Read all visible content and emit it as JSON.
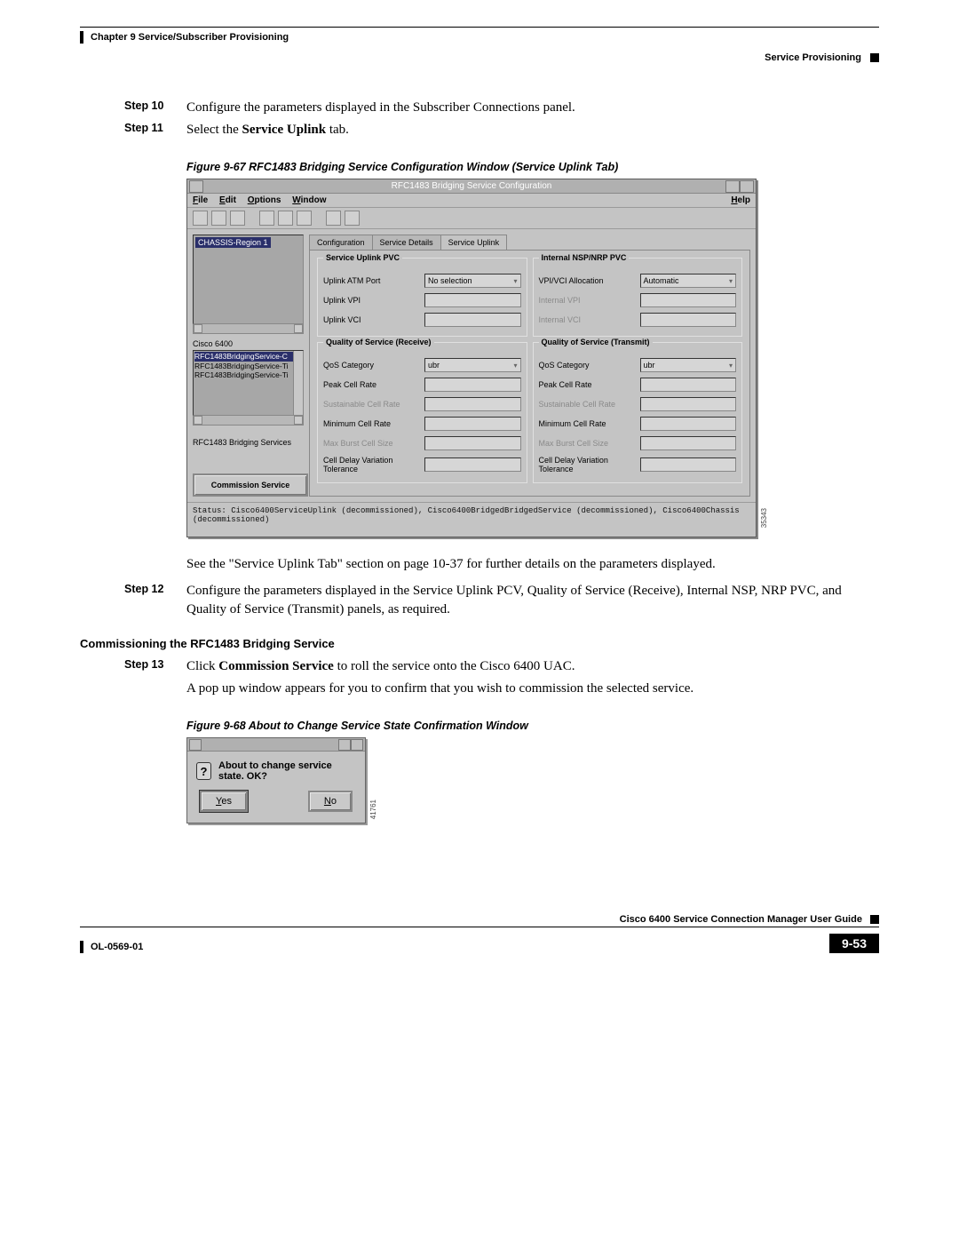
{
  "header": {
    "chapter": "Chapter 9    Service/Subscriber Provisioning",
    "section": "Service Provisioning"
  },
  "steps": {
    "s10": {
      "label": "Step 10",
      "text": "Configure the parameters displayed in the Subscriber Connections panel."
    },
    "s11": {
      "label": "Step 11",
      "prefix": "Select the ",
      "bold": "Service Uplink",
      "suffix": " tab."
    },
    "s12": {
      "label": "Step 12",
      "text": "Configure the parameters displayed in the Service Uplink PCV, Quality of Service (Receive), Internal NSP, NRP PVC, and Quality of Service (Transmit) panels, as required."
    },
    "s13": {
      "label": "Step 13",
      "prefix": "Click ",
      "bold": "Commission Service",
      "suffix": " to roll the service onto the Cisco 6400 UAC."
    }
  },
  "captions": {
    "f67": "Figure 9-67   RFC1483 Bridging Service Configuration Window (Service Uplink Tab)",
    "f68": "Figure 9-68   About to Change Service State Confirmation Window"
  },
  "paragraph_after_fig": "See the \"Service Uplink Tab\" section on page 10-37 for further details on the parameters displayed.",
  "commission_heading": "Commissioning the RFC1483 Bridging Service",
  "popup_paragraph": "A pop up window appears for you to confirm that you wish to commission the selected service.",
  "window": {
    "title": "RFC1483 Bridging Service Configuration",
    "menus": {
      "file": "File",
      "edit": "Edit",
      "options": "Options",
      "window": "Window",
      "help": "Help"
    },
    "tree_selected": "CHASSIS-Region 1",
    "cisco_label": "Cisco 6400",
    "list": {
      "items": [
        "RFC1483BridgingService-C",
        "RFC1483BridgingService-Ti",
        "RFC1483BridgingService-Ti"
      ]
    },
    "services_label": "RFC1483 Bridging Services",
    "commission_btn": "Commission Service",
    "tabs": {
      "configuration": "Configuration",
      "service_details": "Service Details",
      "service_uplink": "Service Uplink"
    },
    "field_groups": {
      "su_pvc": {
        "legend": "Service Uplink PVC",
        "uplink_atm_port": "Uplink ATM Port",
        "uplink_atm_port_val": "No selection",
        "uplink_vpi": "Uplink VPI",
        "uplink_vci": "Uplink VCI"
      },
      "int_pvc": {
        "legend": "Internal NSP/NRP PVC",
        "vpivci_alloc": "VPI/VCI Allocation",
        "vpivci_alloc_val": "Automatic",
        "internal_vpi": "Internal VPI",
        "internal_vci": "Internal VCI"
      },
      "qos_r": {
        "legend": "Quality of Service (Receive)",
        "qos_cat": "QoS Category",
        "qos_cat_val": "ubr",
        "peak": "Peak Cell Rate",
        "sust": "Sustainable Cell Rate",
        "min": "Minimum Cell Rate",
        "maxb": "Max Burst Cell Size",
        "cdvt": "Cell Delay Variation Tolerance"
      },
      "qos_t": {
        "legend": "Quality of Service (Transmit)",
        "qos_cat": "QoS Category",
        "qos_cat_val": "ubr",
        "peak": "Peak Cell Rate",
        "sust": "Sustainable Cell Rate",
        "min": "Minimum Cell Rate",
        "maxb": "Max Burst Cell Size",
        "cdvt": "Cell Delay Variation Tolerance"
      }
    },
    "status": "Status: Cisco6400ServiceUplink (decommissioned), Cisco6400BridgedBridgedService (decommissioned), Cisco6400Chassis (decommissioned)",
    "fig_id": "35343"
  },
  "dialog": {
    "text": "About to change service state. OK?",
    "yes": "Yes",
    "no": "No",
    "fig_id": "41761"
  },
  "footer": {
    "doc_title": "Cisco 6400 Service Connection Manager User Guide",
    "doc_id": "OL-0569-01",
    "page_num": "9-53"
  }
}
